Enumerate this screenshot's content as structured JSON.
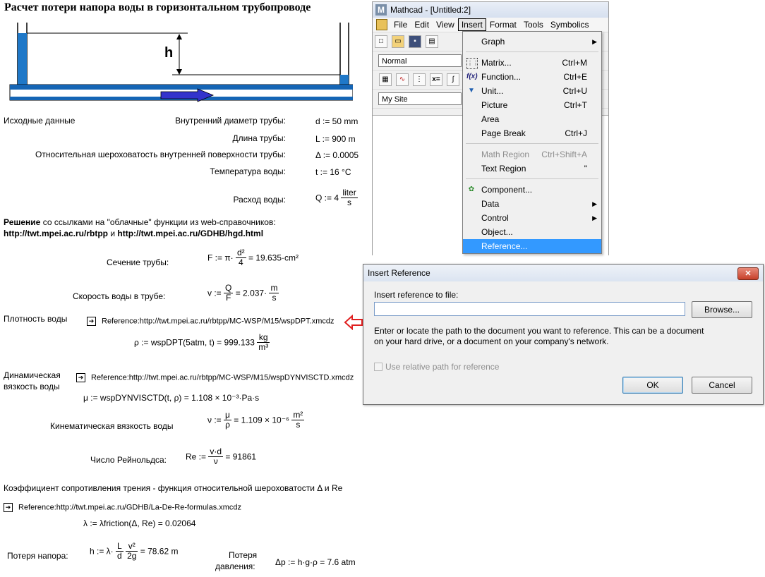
{
  "worksheet": {
    "title": "Расчет потери напора воды в горизонтальном трубопроводе",
    "diagram": {
      "h_label": "h"
    },
    "inputs": {
      "section": "Исходные данные",
      "diameter_label": "Внутренний диаметр трубы:",
      "diameter_expr": "d := 50 mm",
      "length_label": "Длина трубы:",
      "length_expr": "L := 900 m",
      "roughness_label": "Относительная шероховатость внутренней поверхности трубы:",
      "roughness_expr": "Δ := 0.0005",
      "temp_label": "Температура воды:",
      "temp_expr": "t := 16 °C",
      "flow_label": "Расход воды:",
      "flow_lhs": "Q := 4",
      "flow_num": "liter",
      "flow_den": "s"
    },
    "solution": {
      "bold_word": "Решение",
      "intro": " со ссылками на \"облачные\" функции из web-справочников:",
      "link1": "http://twt.mpei.ac.ru/rbtpp",
      "and": " и ",
      "link2": "http://twt.mpei.ac.ru/GDHB/hgd.html"
    },
    "section_area": {
      "label": "Сечение трубы:",
      "lhs": "F := π·",
      "num": "d²",
      "den": "4",
      "rhs": "= 19.635·cm²"
    },
    "velocity": {
      "label": "Скорость воды в трубе:",
      "lhs": "v :=",
      "num": "Q",
      "den": "F",
      "rhs": "= 2.037·",
      "unum": "m",
      "uden": "s"
    },
    "density": {
      "label": "Плотность воды",
      "ref": "Reference:http://twt.mpei.ac.ru/rbtpp/MC-WSP/M15/wspDPT.xmcdz",
      "expr": "ρ := wspDPT(5atm, t) = 999.133",
      "unum": "kg",
      "uden": "m³"
    },
    "dynvisc": {
      "label1": "Динамическая",
      "label2": "вязкость воды",
      "ref": "Reference:http://twt.mpei.ac.ru/rbtpp/MC-WSP/M15/wspDYNVISCTD.xmcdz",
      "expr": "μ := wspDYNVISCTD(t, ρ) = 1.108 × 10⁻³·Pa·s"
    },
    "kinvisc": {
      "label": "Кинематическая вязкость воды",
      "lhs": "ν :=",
      "num": "μ",
      "den": "ρ",
      "rhs": "= 1.109 × 10⁻⁶",
      "unum": "m²",
      "uden": "s"
    },
    "reynolds": {
      "label": "Число Рейнольдса:",
      "lhs": "Re :=",
      "num": "v·d",
      "den": "ν",
      "rhs": "= 91861"
    },
    "friction": {
      "label": "Коэффициент сопротивления трения - функция относительной шероховатости Δ и Re",
      "ref": "Reference:http://twt.mpei.ac.ru/GDHB/La-De-Re-formulas.xmcdz",
      "expr": "λ := λfriction(Δ, Re) = 0.02064"
    },
    "headloss": {
      "label": "Потеря напора:",
      "lhs": "h := λ·",
      "n1": "L",
      "d1": "d",
      "n2": "v²",
      "d2": "2g",
      "rhs": "= 78.62 m"
    },
    "pressure": {
      "label1": "Потеря",
      "label2": "давления:",
      "expr": "Δp := h·g·ρ = 7.6 atm"
    }
  },
  "mathcad": {
    "title": "Mathcad - [Untitled:2]",
    "menubar": [
      "File",
      "Edit",
      "View",
      "Insert",
      "Format",
      "Tools",
      "Symbolics"
    ],
    "style_combo": "Normal",
    "site_combo": "My Site"
  },
  "insert_menu": {
    "items": [
      {
        "label": "Graph",
        "shortcut": "",
        "arrow": "▶"
      },
      {
        "label": "Matrix...",
        "shortcut": "Ctrl+M"
      },
      {
        "label": "Function...",
        "shortcut": "Ctrl+E"
      },
      {
        "label": "Unit...",
        "shortcut": "Ctrl+U"
      },
      {
        "label": "Picture",
        "shortcut": "Ctrl+T"
      },
      {
        "label": "Area",
        "shortcut": ""
      },
      {
        "label": "Page Break",
        "shortcut": "Ctrl+J"
      },
      {
        "label": "Math Region",
        "shortcut": "Ctrl+Shift+A"
      },
      {
        "label": "Text Region",
        "shortcut": "\""
      },
      {
        "label": "Component...",
        "shortcut": ""
      },
      {
        "label": "Data",
        "shortcut": "",
        "arrow": "▶"
      },
      {
        "label": "Control",
        "shortcut": "",
        "arrow": "▶"
      },
      {
        "label": "Object...",
        "shortcut": ""
      },
      {
        "label": "Reference...",
        "shortcut": ""
      }
    ]
  },
  "dialog": {
    "title": "Insert Reference",
    "field_label": "Insert reference to file:",
    "field_value": "",
    "browse": "Browse...",
    "help_line1": "Enter or locate the path to the document you want to reference. This can be a document",
    "help_line2": "on your hard drive, or a document on your company's network.",
    "checkbox_label": "Use relative path for reference",
    "ok": "OK",
    "cancel": "Cancel"
  },
  "colors": {
    "water": "#1f78c8",
    "pipe": "#1565b5",
    "arrow_fill": "#3333cc",
    "highlight": "#3399ff",
    "red_arrow": "#e02020"
  }
}
